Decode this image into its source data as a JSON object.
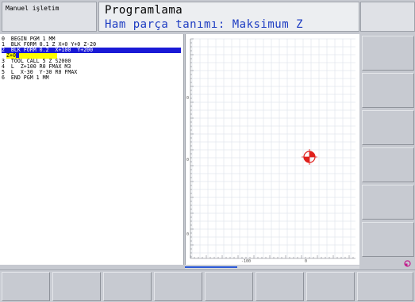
{
  "header": {
    "mode": "Manuel işletim",
    "title": "Programlama",
    "subtitle": "Ham parça tanımı: Maksimum Z"
  },
  "program": {
    "lines": [
      "0  BEGIN PGM 1 MM",
      "1  BLK FORM 0.1 Z X+0 Y+0 Z-20",
      "2  BLK FORM 0.2  X+100  Y+200",
      "3  TOOL CALL 5 Z S2000",
      "4  L  Z+100 R0 FMAX M3",
      "5  L  X-30  Y-30 R0 FMAX",
      "6  END PGM 1 MM"
    ],
    "selected_index": 2,
    "edit_value": "Z+0"
  },
  "graphic": {
    "x_tick_labels": [
      "-100",
      "0"
    ],
    "y_tick_labels": [
      "0",
      "0",
      "0"
    ],
    "grid_color": "#d6dde6",
    "marker_color": "#e0201c"
  },
  "softkeys": {
    "right": [
      "",
      "",
      "",
      "",
      "",
      ""
    ],
    "bottom": [
      "",
      "",
      "",
      "",
      "",
      "",
      "",
      ""
    ]
  }
}
